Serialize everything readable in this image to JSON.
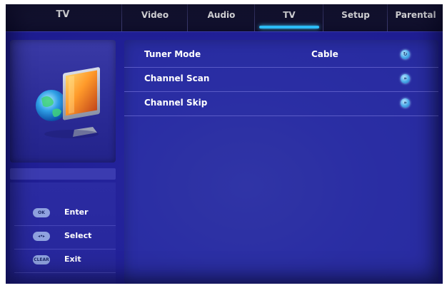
{
  "app": {
    "title": "TV"
  },
  "tabs": [
    {
      "label": "Video",
      "active": false
    },
    {
      "label": "Audio",
      "active": false
    },
    {
      "label": "TV",
      "active": true
    },
    {
      "label": "Setup",
      "active": false
    },
    {
      "label": "Parental",
      "active": false
    }
  ],
  "menu": {
    "items": [
      {
        "label": "Tuner Mode",
        "value": "Cable",
        "icon": "cycle-icon"
      },
      {
        "label": "Channel Scan",
        "value": "",
        "icon": "forward-icon"
      },
      {
        "label": "Channel Skip",
        "value": "",
        "icon": "forward-icon"
      }
    ]
  },
  "help": {
    "items": [
      {
        "key": "OK",
        "label": "Enter",
        "icon": "ok-key-icon"
      },
      {
        "key": "◂•▸",
        "label": "Select",
        "icon": "dpad-key-icon"
      },
      {
        "key": "CLEAR",
        "label": "Exit",
        "icon": "clear-key-icon"
      }
    ]
  },
  "colors": {
    "accent": "#2ec3ff",
    "background": "#23229a"
  }
}
